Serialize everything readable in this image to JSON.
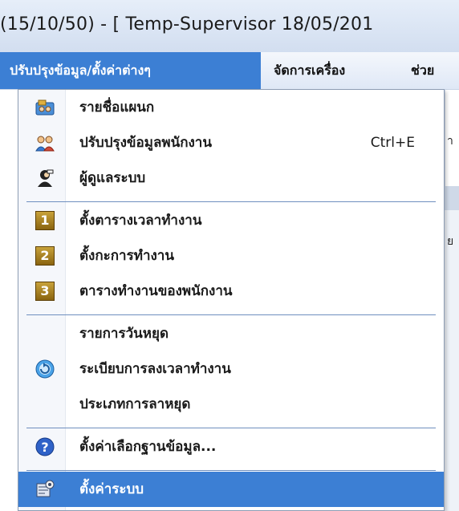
{
  "window": {
    "title": "(15/10/50) - [ Temp-Supervisor 18/05/201"
  },
  "menubar": {
    "items": [
      {
        "label": "ปรับปรุงข้อมูล/ตั้งค่าต่างๆ",
        "active": true
      },
      {
        "label": "จัดการเครื่อง",
        "active": false
      },
      {
        "label": "ช่วย",
        "active": false
      }
    ]
  },
  "background_text": [
    "า",
    "ย"
  ],
  "dropdown": {
    "items": [
      {
        "label": "รายชื่อแผนก",
        "icon": "department-icon"
      },
      {
        "label": "ปรับปรุงข้อมูลพนักงาน",
        "shortcut": "Ctrl+E",
        "icon": "employees-icon"
      },
      {
        "label": "ผู้ดูแลระบบ",
        "icon": "admin-icon"
      },
      {
        "label": "ตั้งตารางเวลาทำงาน",
        "icon": "number-1-icon",
        "icon_text": "1"
      },
      {
        "label": "ตั้งกะการทำงาน",
        "icon": "number-2-icon",
        "icon_text": "2"
      },
      {
        "label": "ตารางทำงานของพนักงาน",
        "icon": "number-3-icon",
        "icon_text": "3"
      },
      {
        "label": "รายการวันหยุด",
        "icon": ""
      },
      {
        "label": "ระเบียบการลงเวลาทำงาน",
        "icon": "refresh-arrow-icon"
      },
      {
        "label": "ประเภทการลาหยุด",
        "icon": ""
      },
      {
        "label": "ตั้งค่าเลือกฐานข้อมูล...",
        "icon": "help-icon"
      },
      {
        "label": "ตั้งค่าระบบ",
        "icon": "system-settings-icon",
        "highlighted": true
      }
    ]
  }
}
